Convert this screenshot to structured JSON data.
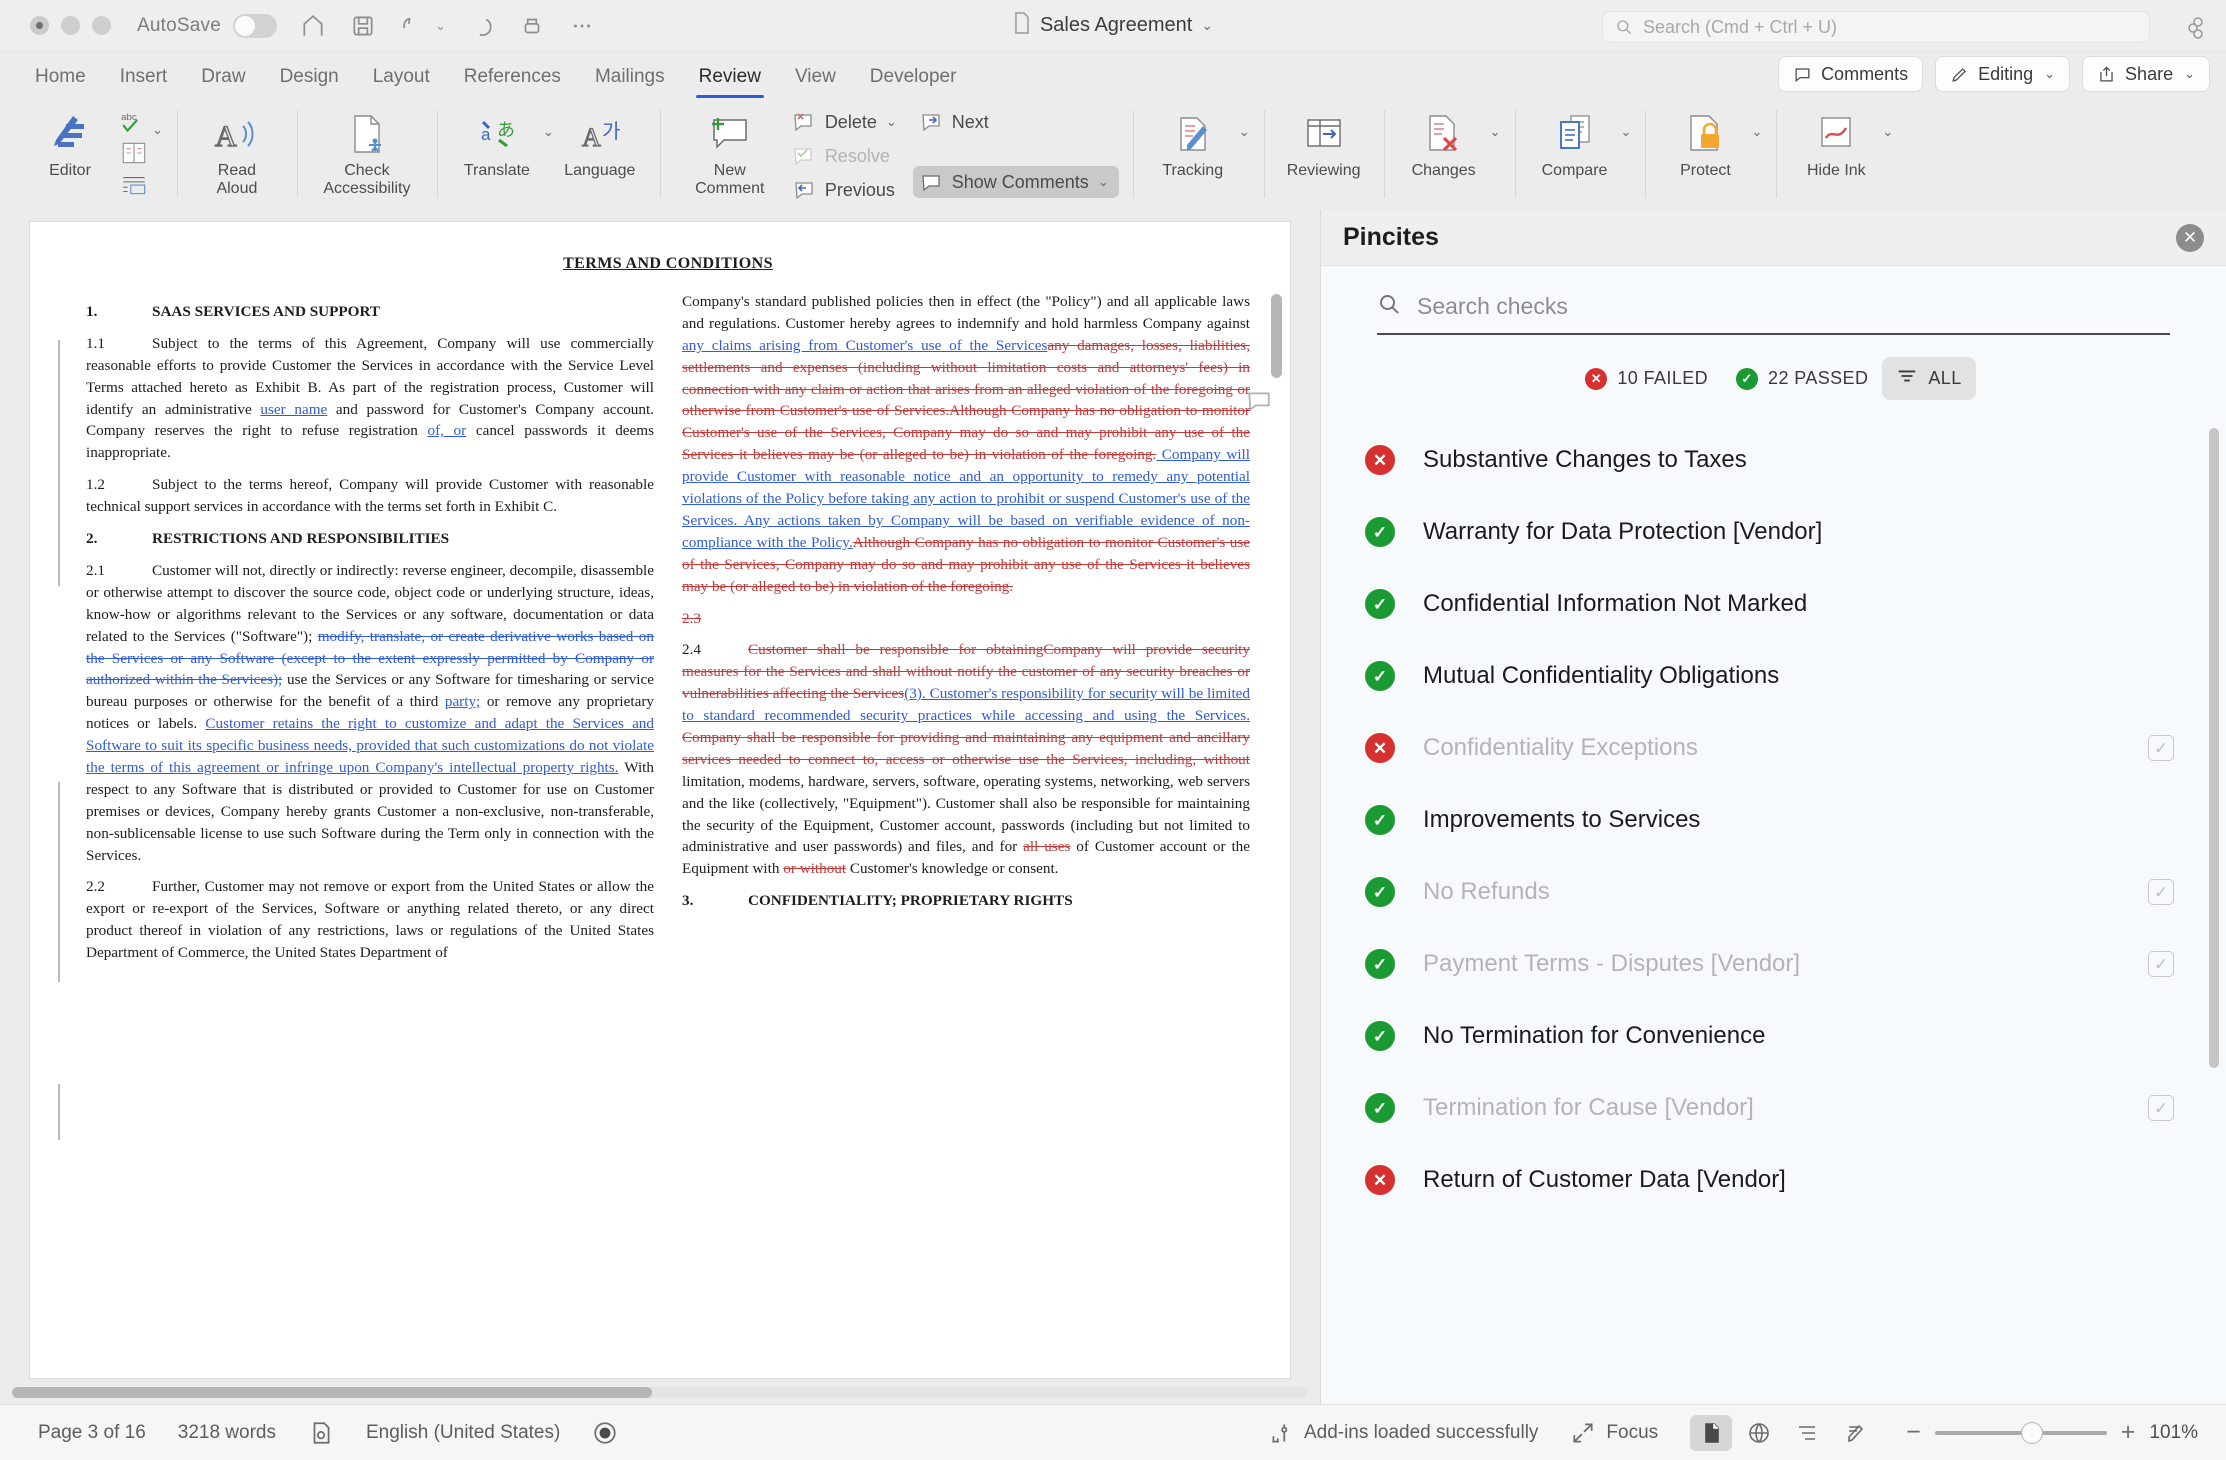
{
  "titlebar": {
    "autosave_label": "AutoSave",
    "doc_title": "Sales Agreement",
    "search_placeholder": "Search (Cmd + Ctrl + U)",
    "icons": [
      "home-icon",
      "save-icon",
      "undo-icon",
      "redo-icon",
      "print-icon",
      "more-icon"
    ]
  },
  "tabs": [
    {
      "label": "Home",
      "active": false
    },
    {
      "label": "Insert",
      "active": false
    },
    {
      "label": "Draw",
      "active": false
    },
    {
      "label": "Design",
      "active": false
    },
    {
      "label": "Layout",
      "active": false
    },
    {
      "label": "References",
      "active": false
    },
    {
      "label": "Mailings",
      "active": false
    },
    {
      "label": "Review",
      "active": true
    },
    {
      "label": "View",
      "active": false
    },
    {
      "label": "Developer",
      "active": false
    }
  ],
  "tab_actions": {
    "comments": "Comments",
    "editing": "Editing",
    "share": "Share"
  },
  "ribbon": {
    "editor": "Editor",
    "read_aloud": "Read\nAloud",
    "read_aloud_l1": "Read",
    "read_aloud_l2": "Aloud",
    "check_accessibility_l1": "Check",
    "check_accessibility_l2": "Accessibility",
    "translate": "Translate",
    "language": "Language",
    "new_comment_l1": "New",
    "new_comment_l2": "Comment",
    "delete": "Delete",
    "resolve": "Resolve",
    "next": "Next",
    "previous": "Previous",
    "show_comments": "Show Comments",
    "tracking": "Tracking",
    "reviewing": "Reviewing",
    "changes": "Changes",
    "compare": "Compare",
    "protect": "Protect",
    "hide_ink": "Hide Ink"
  },
  "document": {
    "heading": "TERMS AND CONDITIONS",
    "left_column": {
      "s1_num": "1.",
      "s1_title": "SAAS SERVICES AND SUPPORT",
      "p11_num": "1.1",
      "p11_a": "Subject to the terms of this Agreement, Company will use commercially reasonable efforts to provide Customer the Services in accordance with the Service Level Terms attached hereto as Exhibit B.   As part of the registration process, Customer will identify an administrative ",
      "p11_ins1": "user name",
      "p11_b": " and password for Customer's Company account.    Company reserves the right to refuse registration ",
      "p11_ins2": "of, or",
      "p11_c": " cancel passwords it deems inappropriate.",
      "p12_num": "1.2",
      "p12_a": "Subject to the terms hereof, Company will provide Customer with reasonable technical support services in accordance with the terms set forth in Exhibit C.",
      "s2_num": "2.",
      "s2_title": "RESTRICTIONS AND RESPONSIBILITIES",
      "p21_num": "2.1",
      "p21_a": "Customer will not, directly or indirectly: reverse engineer, decompile, disassemble or otherwise attempt to discover the source code, object code or underlying structure, ideas, know-how or algorithms relevant to the Services or any software, documentation or data related to the Services (\"Software\"); ",
      "p21_del1": "modify, translate, or create derivative works based on the Services or any Software (except to the extent expressly permitted by Company or authorized within the Services);",
      "p21_b": " use the Services or any Software for timesharing or service bureau purposes or otherwise for the benefit of a third ",
      "p21_ins1": "party;",
      "p21_c": " or remove any proprietary notices or labels. ",
      "p21_ins2": " Customer retains the right to customize and adapt the Services and Software to suit its specific business needs, provided that such customizations do not violate the terms of this agreement or infringe upon Company's intellectual property rights.",
      "p21_d": "  With respect to any Software that is distributed or provided to Customer for use on Customer premises or devices, Company hereby grants Customer a non-exclusive, non-transferable, non-sublicensable license to use such Software during the Term only in connection with the Services.",
      "p22_num": "2.2",
      "p22_a": "Further, Customer may not remove or export from the United States or allow the export or re-export of the Services, Software or anything related thereto, or any direct product thereof in violation of any restrictions, laws or regulations of the United States Department of Commerce, the United States Department of"
    },
    "right_column": {
      "p_top_a": "Company's standard published policies then in effect (the \"Policy\") and all applicable laws and regulations.   Customer hereby agrees to indemnify and hold harmless Company against ",
      "p_top_ins": "any claims arising from Customer's use of the Services",
      "p_top_del": "any damages, losses, liabilities, settlements and expenses (including without limitation costs and attorneys' fees) in connection with any claim or action that arises from an alleged violation of the foregoing or otherwise from Customer's use of Services.",
      "p_top_del2": "Although Company has no obligation to monitor Customer's use of the Services, Company may do so and may prohibit any use of the Services it believes may be (or alleged to be) in violation of the foregoing.",
      "p_top_ins2": "  Company will provide Customer with reasonable notice and an opportunity to remedy any potential violations of the Policy before taking any action to prohibit or suspend Customer's use of the Services. Any actions taken by Company will be based on verifiable evidence of non-compliance with the Policy.",
      "p_top_del3": "Although Company has no obligation to monitor Customer's use of the Services, Company may do so and may prohibit any use of the Services it believes may be (or alleged to be) in violation of the foregoing.",
      "p23_num": "2.3",
      "p24_num": "2.4",
      "p24_del1": "Customer shall be responsible for obtaining",
      "p24_del2": "Company will provide security measures for the Services and shall without notify the customer of any security breaches or vulnerabilities affecting the Services",
      "p24_ins1": "(3)",
      "p24_ins2": ".  Customer's responsibility for security will be limited to standard recommended security practices while accessing and using the Services.",
      "p24_del3": " Company shall be responsible for providing and maintaining any equipment and ancillary services needed to connect to, access or otherwise use the Services, including, without ",
      "p24_a": "limitation, modems, hardware, servers, software, operating systems, networking, web servers and the like (collectively, \"Equipment\").   Customer shall also be responsible for maintaining the security of the Equipment, Customer account, passwords (including but not limited to administrative and user passwords) and files, and for ",
      "p24_del4": "all uses",
      "p24_b": " of Customer account or the Equipment with ",
      "p24_del5": "or without",
      "p24_c": " Customer's knowledge or consent.",
      "s3_num": "3.",
      "s3_title": "CONFIDENTIALITY; PROPRIETARY RIGHTS"
    }
  },
  "panel": {
    "title": "Pincites",
    "search_placeholder": "Search checks",
    "filters": [
      {
        "label": "10 FAILED",
        "icon": "fail-badge-icon",
        "active": false
      },
      {
        "label": "22 PASSED",
        "icon": "pass-badge-icon",
        "active": false
      },
      {
        "label": "ALL",
        "icon": "filter-lines-icon",
        "active": true
      }
    ],
    "checks": [
      {
        "label": "Substantive Changes to Taxes",
        "status": "fail",
        "dim": false,
        "checkbox": false
      },
      {
        "label": "Warranty for Data Protection [Vendor]",
        "status": "pass",
        "dim": false,
        "checkbox": false
      },
      {
        "label": "Confidential Information Not Marked",
        "status": "pass",
        "dim": false,
        "checkbox": false
      },
      {
        "label": "Mutual Confidentiality Obligations",
        "status": "pass",
        "dim": false,
        "checkbox": false
      },
      {
        "label": "Confidentiality Exceptions",
        "status": "fail",
        "dim": true,
        "checkbox": true
      },
      {
        "label": "Improvements to Services",
        "status": "pass",
        "dim": false,
        "checkbox": false
      },
      {
        "label": "No Refunds",
        "status": "pass",
        "dim": true,
        "checkbox": true
      },
      {
        "label": "Payment Terms - Disputes [Vendor]",
        "status": "pass",
        "dim": true,
        "checkbox": true
      },
      {
        "label": "No Termination for Convenience",
        "status": "pass",
        "dim": false,
        "checkbox": false
      },
      {
        "label": "Termination for Cause [Vendor]",
        "status": "pass",
        "dim": true,
        "checkbox": true
      },
      {
        "label": "Return of Customer Data [Vendor]",
        "status": "fail",
        "dim": false,
        "checkbox": false
      }
    ]
  },
  "statusbar": {
    "page": "Page 3 of 16",
    "words": "3218 words",
    "language": "English (United States)",
    "addins": "Add-ins loaded successfully",
    "focus": "Focus",
    "zoom": "101%"
  },
  "colors": {
    "accent_blue": "#2f5bd7",
    "fail_red": "#d73030",
    "pass_green": "#1a9a31",
    "deletion_red": "#c23b3b",
    "insertion_blue": "#2f5bd7"
  }
}
